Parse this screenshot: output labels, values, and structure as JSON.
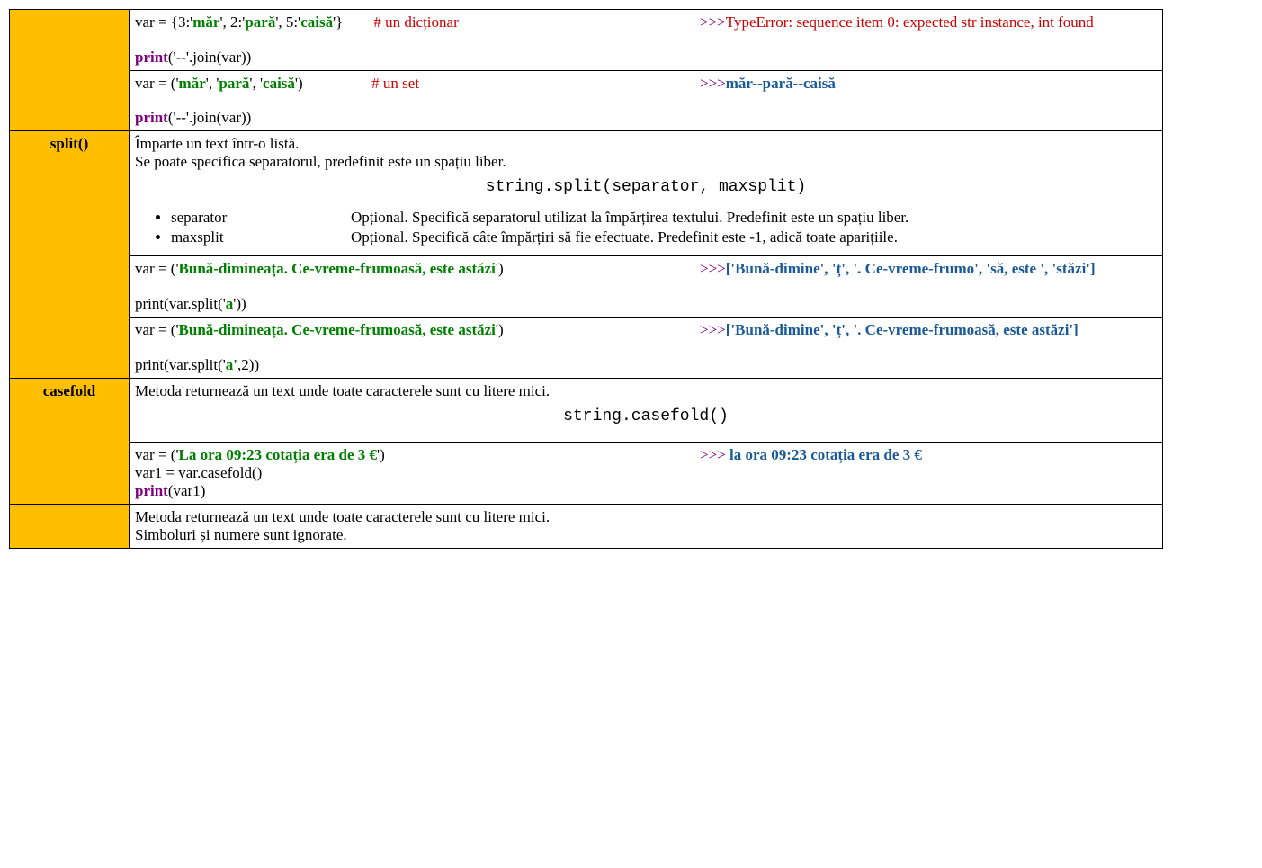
{
  "row1": {
    "code_l1_a": "var = {3:'",
    "code_l1_b": "măr",
    "code_l1_c": "', 2:'",
    "code_l1_d": "pară",
    "code_l1_e": "', 5:'",
    "code_l1_f": "caisă",
    "code_l1_g": "'}",
    "comment1": "# un dicționar",
    "code_l2_a": "print",
    "code_l2_b": "('--'.join(var))",
    "out_prompt": ">>>",
    "out_err": "TypeError: sequence item 0: expected str instance, int found"
  },
  "row2": {
    "code_l1_a": "var = ('",
    "code_l1_b": "măr",
    "code_l1_c": "', '",
    "code_l1_d": "pară",
    "code_l1_e": "', '",
    "code_l1_f": "caisă",
    "code_l1_g": "')",
    "comment1": "# un set",
    "code_l2_a": "print",
    "code_l2_b": "('--'.join(var))",
    "out_prompt": ">>>",
    "out_text": "măr--pară--caisă"
  },
  "split": {
    "name": "split()",
    "desc1": "Împarte un text într-o listă.",
    "desc2": "Se poate specifica separatorul, predefinit este un spațiu liber.",
    "syntax": "string.split(separator, maxsplit)",
    "param1_name": "separator",
    "param1_desc": "Opțional. Specifică separatorul utilizat la împărțirea textului. Predefinit este un spațiu liber.",
    "param2_name": "maxsplit",
    "param2_desc": "Opțional. Specifică câte împărțiri să fie efectuate. Predefinit este -1, adică toate aparițiile.",
    "ex1_l1_a": "var = ('",
    "ex1_l1_b": "Bună-dimineața. Ce-vreme-frumoasă, este astăzi",
    "ex1_l1_c": "')",
    "ex1_l2_a": "print(var.split('",
    "ex1_l2_b": "a",
    "ex1_l2_c": "'))",
    "ex1_out_prompt": ">>>",
    "ex1_out": "['Bună-dimine', 'ț', '. Ce-vreme-frumo', 'să, este ', 'stăzi']",
    "ex2_l1_a": "var = ('",
    "ex2_l1_b": "Bună-dimineața. Ce-vreme-frumoasă, este astăzi",
    "ex2_l1_c": "')",
    "ex2_l2_a": "print(var.split('",
    "ex2_l2_b": "a'",
    "ex2_l2_c": ",2",
    "ex2_l2_d": "))",
    "ex2_out_prompt": ">>>",
    "ex2_out": "['Bună-dimine', 'ț', '. Ce-vreme-frumoasă, este astăzi']"
  },
  "casefold": {
    "name": "casefold",
    "desc": "Metoda returnează un text unde toate caracterele sunt cu litere mici.",
    "syntax": "string.casefold()",
    "ex_l1_a": "var = ('",
    "ex_l1_b": "La ora 09:23 cotația era de 3 €",
    "ex_l1_c": "')",
    "ex_l2": "var1 = var.casefold()",
    "ex_l3_a": "print",
    "ex_l3_b": "(var1)",
    "out_prompt": ">>> ",
    "out_text": "la ora 09:23 cotația era de 3 €"
  },
  "lower": {
    "desc1": "Metoda returnează un text unde toate caracterele sunt cu litere mici.",
    "desc2": "Simboluri și numere sunt ignorate."
  }
}
